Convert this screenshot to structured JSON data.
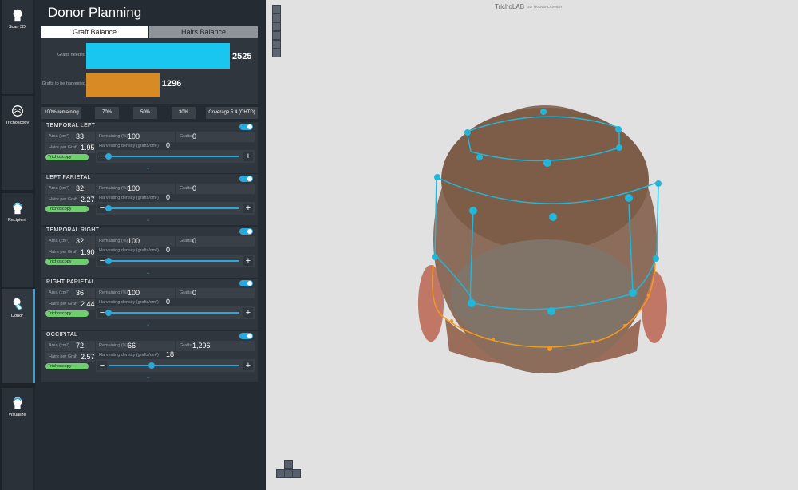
{
  "sidebar": {
    "items": [
      {
        "label": "Scan 3D",
        "icon": "head-scan-icon"
      },
      {
        "label": "Trichoscopy",
        "icon": "trichoscopy-icon"
      },
      {
        "label": "Recipient",
        "icon": "recipient-head-icon"
      },
      {
        "label": "Donor",
        "icon": "donor-hand-icon",
        "active": true
      },
      {
        "label": "Visualize",
        "icon": "visualize-head-icon"
      }
    ]
  },
  "panel": {
    "title": "Donor Planning",
    "tabs": [
      "Graft Balance",
      "Hairs Balance"
    ],
    "balance": {
      "needed_label": "Grafts needed",
      "needed_value": "2525",
      "harvest_label": "Grafts to be harvested",
      "harvest_value": "1296",
      "needed_fraction": 1.0,
      "harvest_fraction": 0.51
    },
    "presets": [
      "100% remaining",
      "70%",
      "50%",
      "30%",
      "Coverage 5.4 (CHTD)"
    ],
    "labels": {
      "area": "Area (cm²)",
      "hairs": "Hairs per Graft",
      "remaining": "Remaining (%)",
      "grafts": "Grafts",
      "density": "Harvesting density (grafts/cm²)",
      "tricho": "Trichoscopy",
      "minus": "−",
      "plus": "+",
      "expand": "⌄"
    },
    "zones": [
      {
        "name": "TEMPORAL LEFT",
        "area": "33",
        "hairs": "1.95",
        "remaining": "100",
        "grafts": "0",
        "density": "0",
        "density_fraction": 0.0,
        "enabled": true
      },
      {
        "name": "LEFT PARIETAL",
        "area": "32",
        "hairs": "2.27",
        "remaining": "100",
        "grafts": "0",
        "density": "0",
        "density_fraction": 0.0,
        "enabled": true
      },
      {
        "name": "TEMPORAL RIGHT",
        "area": "32",
        "hairs": "1.90",
        "remaining": "100",
        "grafts": "0",
        "density": "0",
        "density_fraction": 0.0,
        "enabled": true
      },
      {
        "name": "RIGHT PARIETAL",
        "area": "36",
        "hairs": "2.44",
        "remaining": "100",
        "grafts": "0",
        "density": "0",
        "density_fraction": 0.0,
        "enabled": true
      },
      {
        "name": "OCCIPITAL",
        "area": "72",
        "hairs": "2.57",
        "remaining": "66",
        "grafts": "1,296",
        "density": "18",
        "density_fraction": 0.33,
        "enabled": true
      }
    ]
  },
  "viewport": {
    "brand": "TrichoLAB",
    "brand_sub": "3D TRANSPLANNER",
    "toolbar": [
      "camera-icon",
      "head-front-icon",
      "ruler-icon",
      "pen-icon",
      "shape-icon",
      "head-back-icon"
    ],
    "nav_pad": [
      "view-top-icon",
      "view-left-icon",
      "view-front-icon",
      "view-right-icon"
    ],
    "colors": {
      "accent": "#2aa8d8",
      "occipital": "#f29a1d",
      "harvest_bar": "#d88a25",
      "needed_bar": "#19c6f0"
    }
  }
}
